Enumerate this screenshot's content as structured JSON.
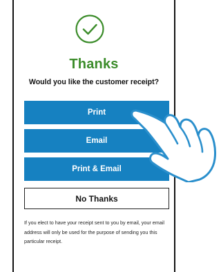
{
  "receipt_screen": {
    "title": "Thanks",
    "question": "Would you like the customer receipt?",
    "buttons": {
      "print": "Print",
      "email": "Email",
      "print_email": "Print & Email",
      "no_thanks": "No Thanks"
    },
    "note": "If you elect to have your receipt sent to you by email, your email address will only be used for the purpose of sending you this particular receipt."
  },
  "colors": {
    "accent_green": "#3b8c2a",
    "button_blue": "#1681c1",
    "hand_outline": "#2a8fcc"
  },
  "icons": {
    "success": "check-circle-icon",
    "pointer": "hand-pointer-icon"
  }
}
